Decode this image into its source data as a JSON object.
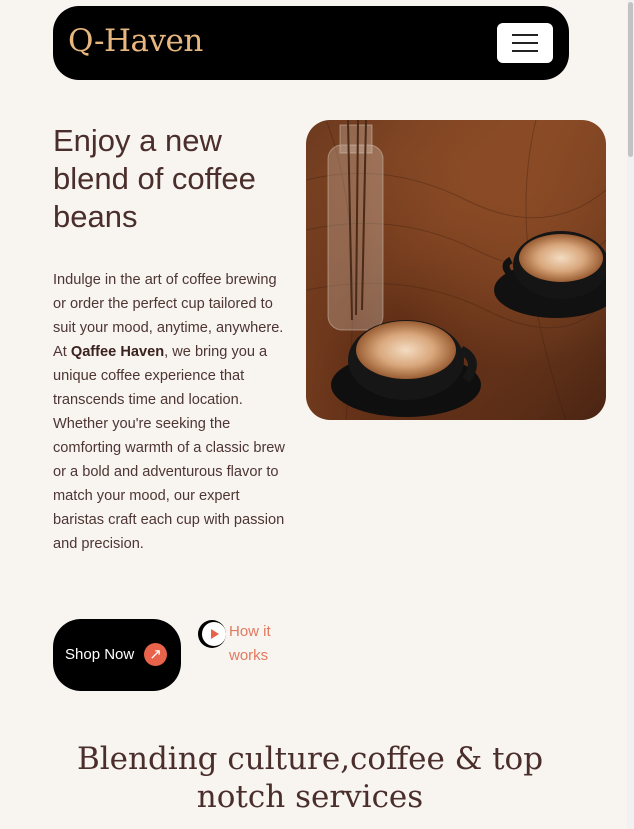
{
  "navbar": {
    "brand": "Q-Haven",
    "menu_icon": "hamburger-menu-icon"
  },
  "hero": {
    "title": "Enjoy a new blend of coffee beans",
    "text_intro": "Indulge in the art of coffee brewing or order the perfect cup tailored to suit your mood, anytime, anywhere. At ",
    "text_brand": "Qaffee Haven",
    "text_rest": ", we bring you a unique coffee experience that transcends time and location. Whether you're seeking the comforting warmth of a classic brew or a bold and adventurous flavor to match your mood, our expert baristas craft each cup with passion and precision.",
    "shop_label": "Shop Now",
    "shop_icon": "arrow-up-right-icon",
    "how_label": "How it works",
    "play_icon": "play-icon"
  },
  "section": {
    "title": "Blending culture,coffee & top notch services"
  },
  "colors": {
    "background": "#f8f4f0",
    "brand": "#e8b77f",
    "accent": "#e9634a",
    "heading": "#4a2e2b"
  }
}
